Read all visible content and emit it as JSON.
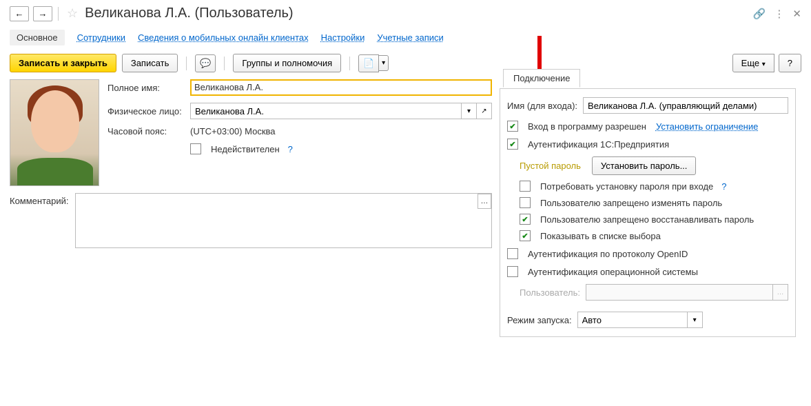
{
  "title": "Великанова Л.А. (Пользователь)",
  "tabs": {
    "main": "Основное",
    "employees": "Сотрудники",
    "mobile": "Сведения о мобильных онлайн клиентах",
    "settings": "Настройки",
    "accounts": "Учетные записи"
  },
  "toolbar": {
    "save_close": "Записать и закрыть",
    "save": "Записать",
    "groups": "Группы и полномочия",
    "more": "Еще",
    "help": "?"
  },
  "fields": {
    "full_name_label": "Полное имя:",
    "full_name_value": "Великанова Л.А.",
    "person_label": "Физическое лицо:",
    "person_value": "Великанова Л.А.",
    "tz_label": "Часовой пояс:",
    "tz_value": "(UTC+03:00) Москва",
    "inactive_label": "Недействителен",
    "inactive_help": "?"
  },
  "comment": {
    "label": "Комментарий:",
    "value": ""
  },
  "panel": {
    "tab": "Подключение",
    "login_label": "Имя (для входа):",
    "login_value": "Великанова Л.А. (управляющий делами)",
    "login_allowed": "Вход в программу разрешен",
    "set_restriction": "Установить ограничение",
    "auth_1c": "Аутентификация 1С:Предприятия",
    "empty_password": "Пустой пароль",
    "set_password": "Установить пароль...",
    "require_pw_change": "Потребовать установку пароля при входе",
    "require_pw_help": "?",
    "forbid_change_pw": "Пользователю запрещено изменять пароль",
    "forbid_restore_pw": "Пользователю запрещено восстанавливать пароль",
    "show_in_list": "Показывать в списке выбора",
    "auth_openid": "Аутентификация по протоколу OpenID",
    "auth_os": "Аутентификация операционной системы",
    "os_user_label": "Пользователь:",
    "os_user_value": "",
    "launch_label": "Режим запуска:",
    "launch_value": "Авто"
  }
}
